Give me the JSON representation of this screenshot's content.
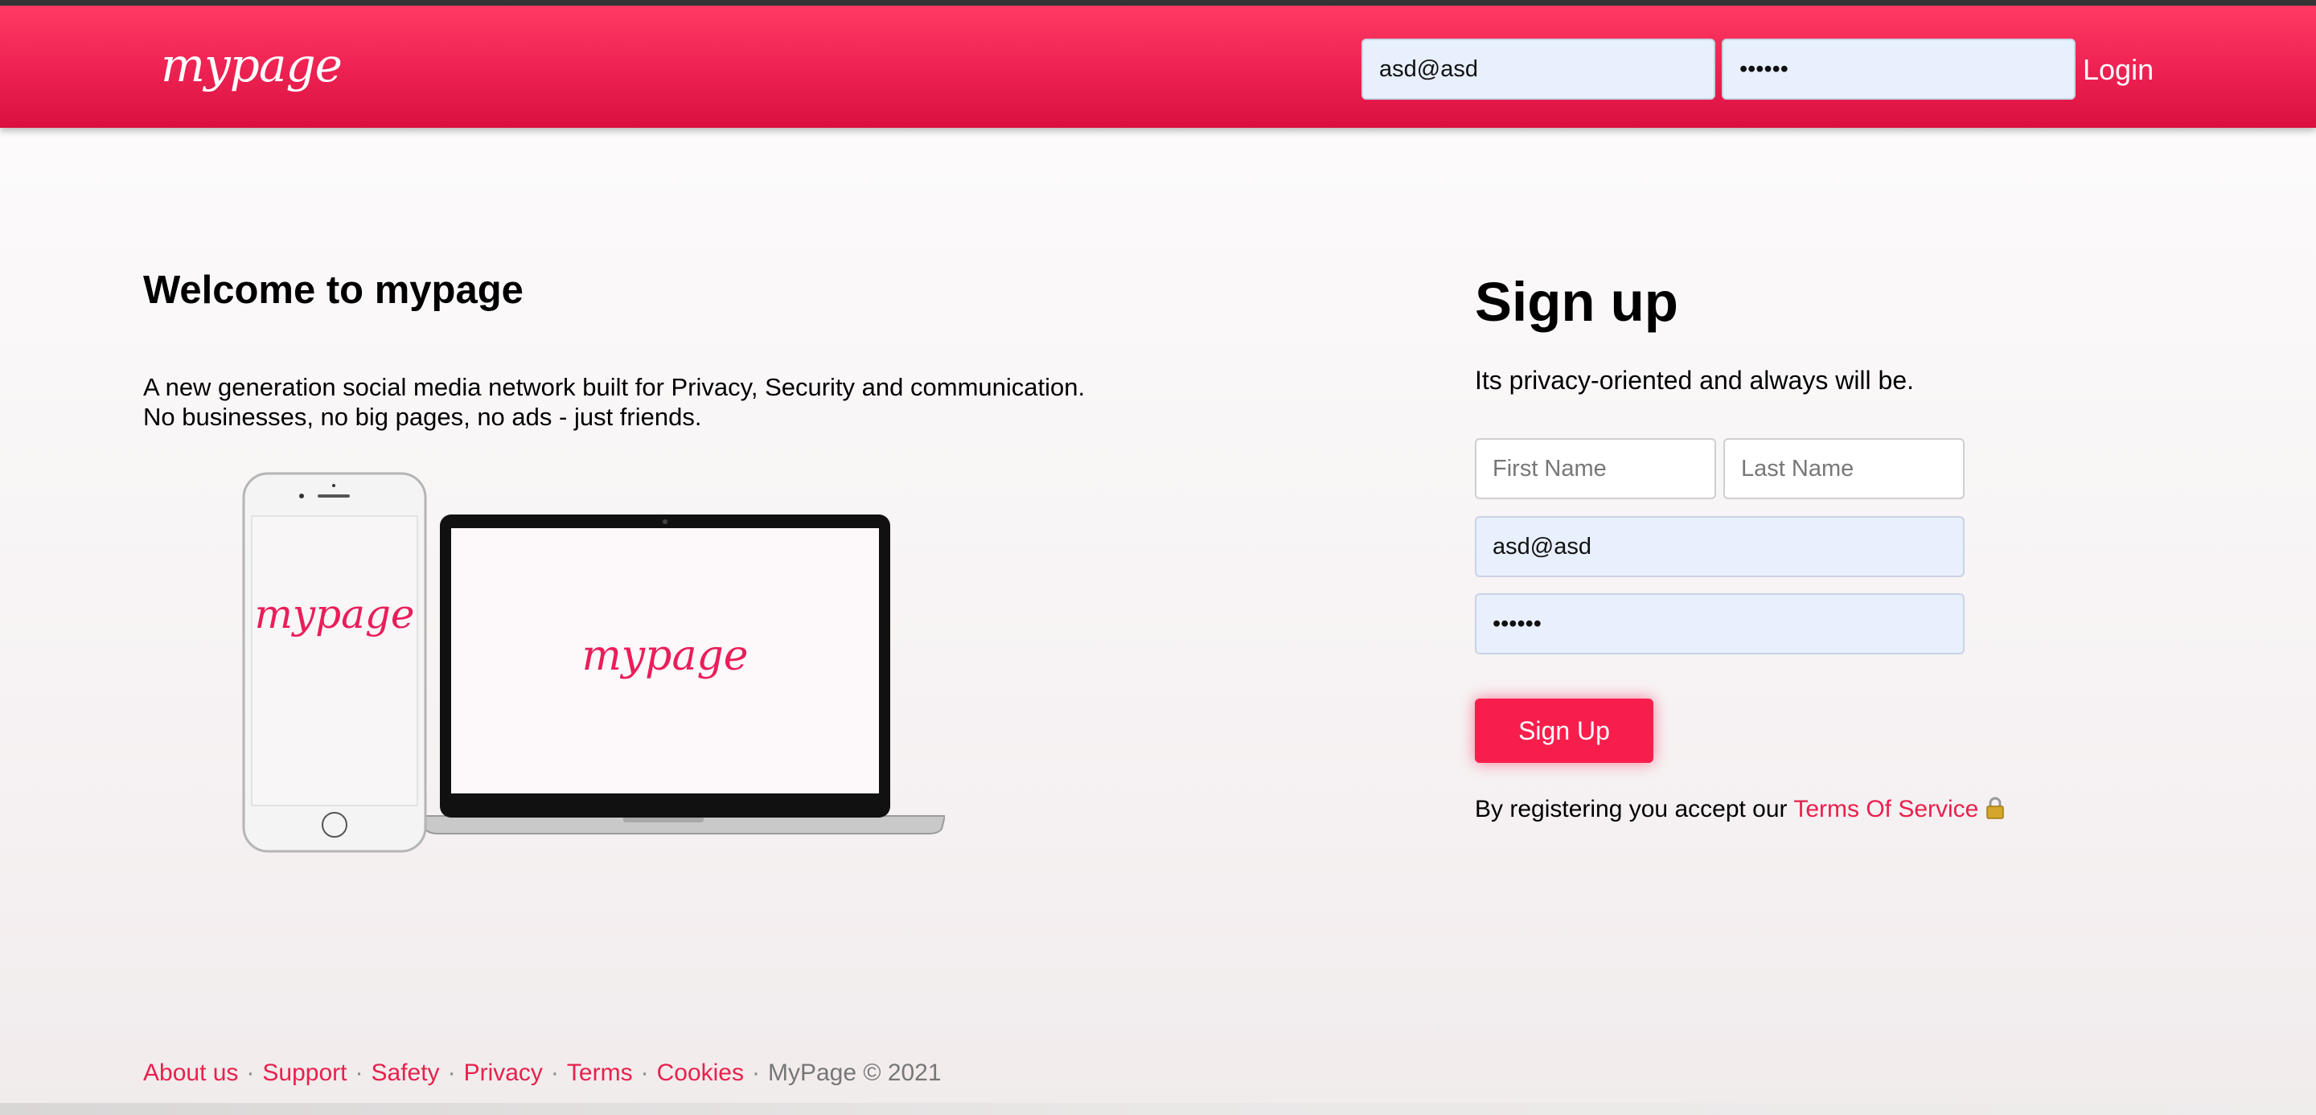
{
  "header": {
    "logo_text": "mypage",
    "email_value": "asd@asd",
    "password_value": "••••••",
    "login_label": "Login"
  },
  "welcome": {
    "title": "Welcome to mypage",
    "line1": "A new generation social media network built for Privacy, Security and communication.",
    "line2": "No businesses, no big pages, no ads - just friends.",
    "phone_logo": "mypage",
    "laptop_logo": "mypage"
  },
  "signup": {
    "title": "Sign up",
    "subtitle": "Its privacy-oriented and always will be.",
    "first_name_placeholder": "First Name",
    "last_name_placeholder": "Last Name",
    "email_value": "asd@asd",
    "password_value": "••••••",
    "button_label": "Sign Up",
    "terms_prefix": "By registering you accept our ",
    "terms_link": "Terms Of Service"
  },
  "footer": {
    "links": [
      "About us",
      "Support",
      "Safety",
      "Privacy",
      "Terms",
      "Cookies"
    ],
    "copyright": "MyPage © 2021"
  },
  "colors": {
    "brand": "#f71e4c",
    "header_gradient_top": "#ff3a63",
    "header_gradient_bottom": "#d9103f",
    "autofill_bg": "#e8f0fe"
  }
}
